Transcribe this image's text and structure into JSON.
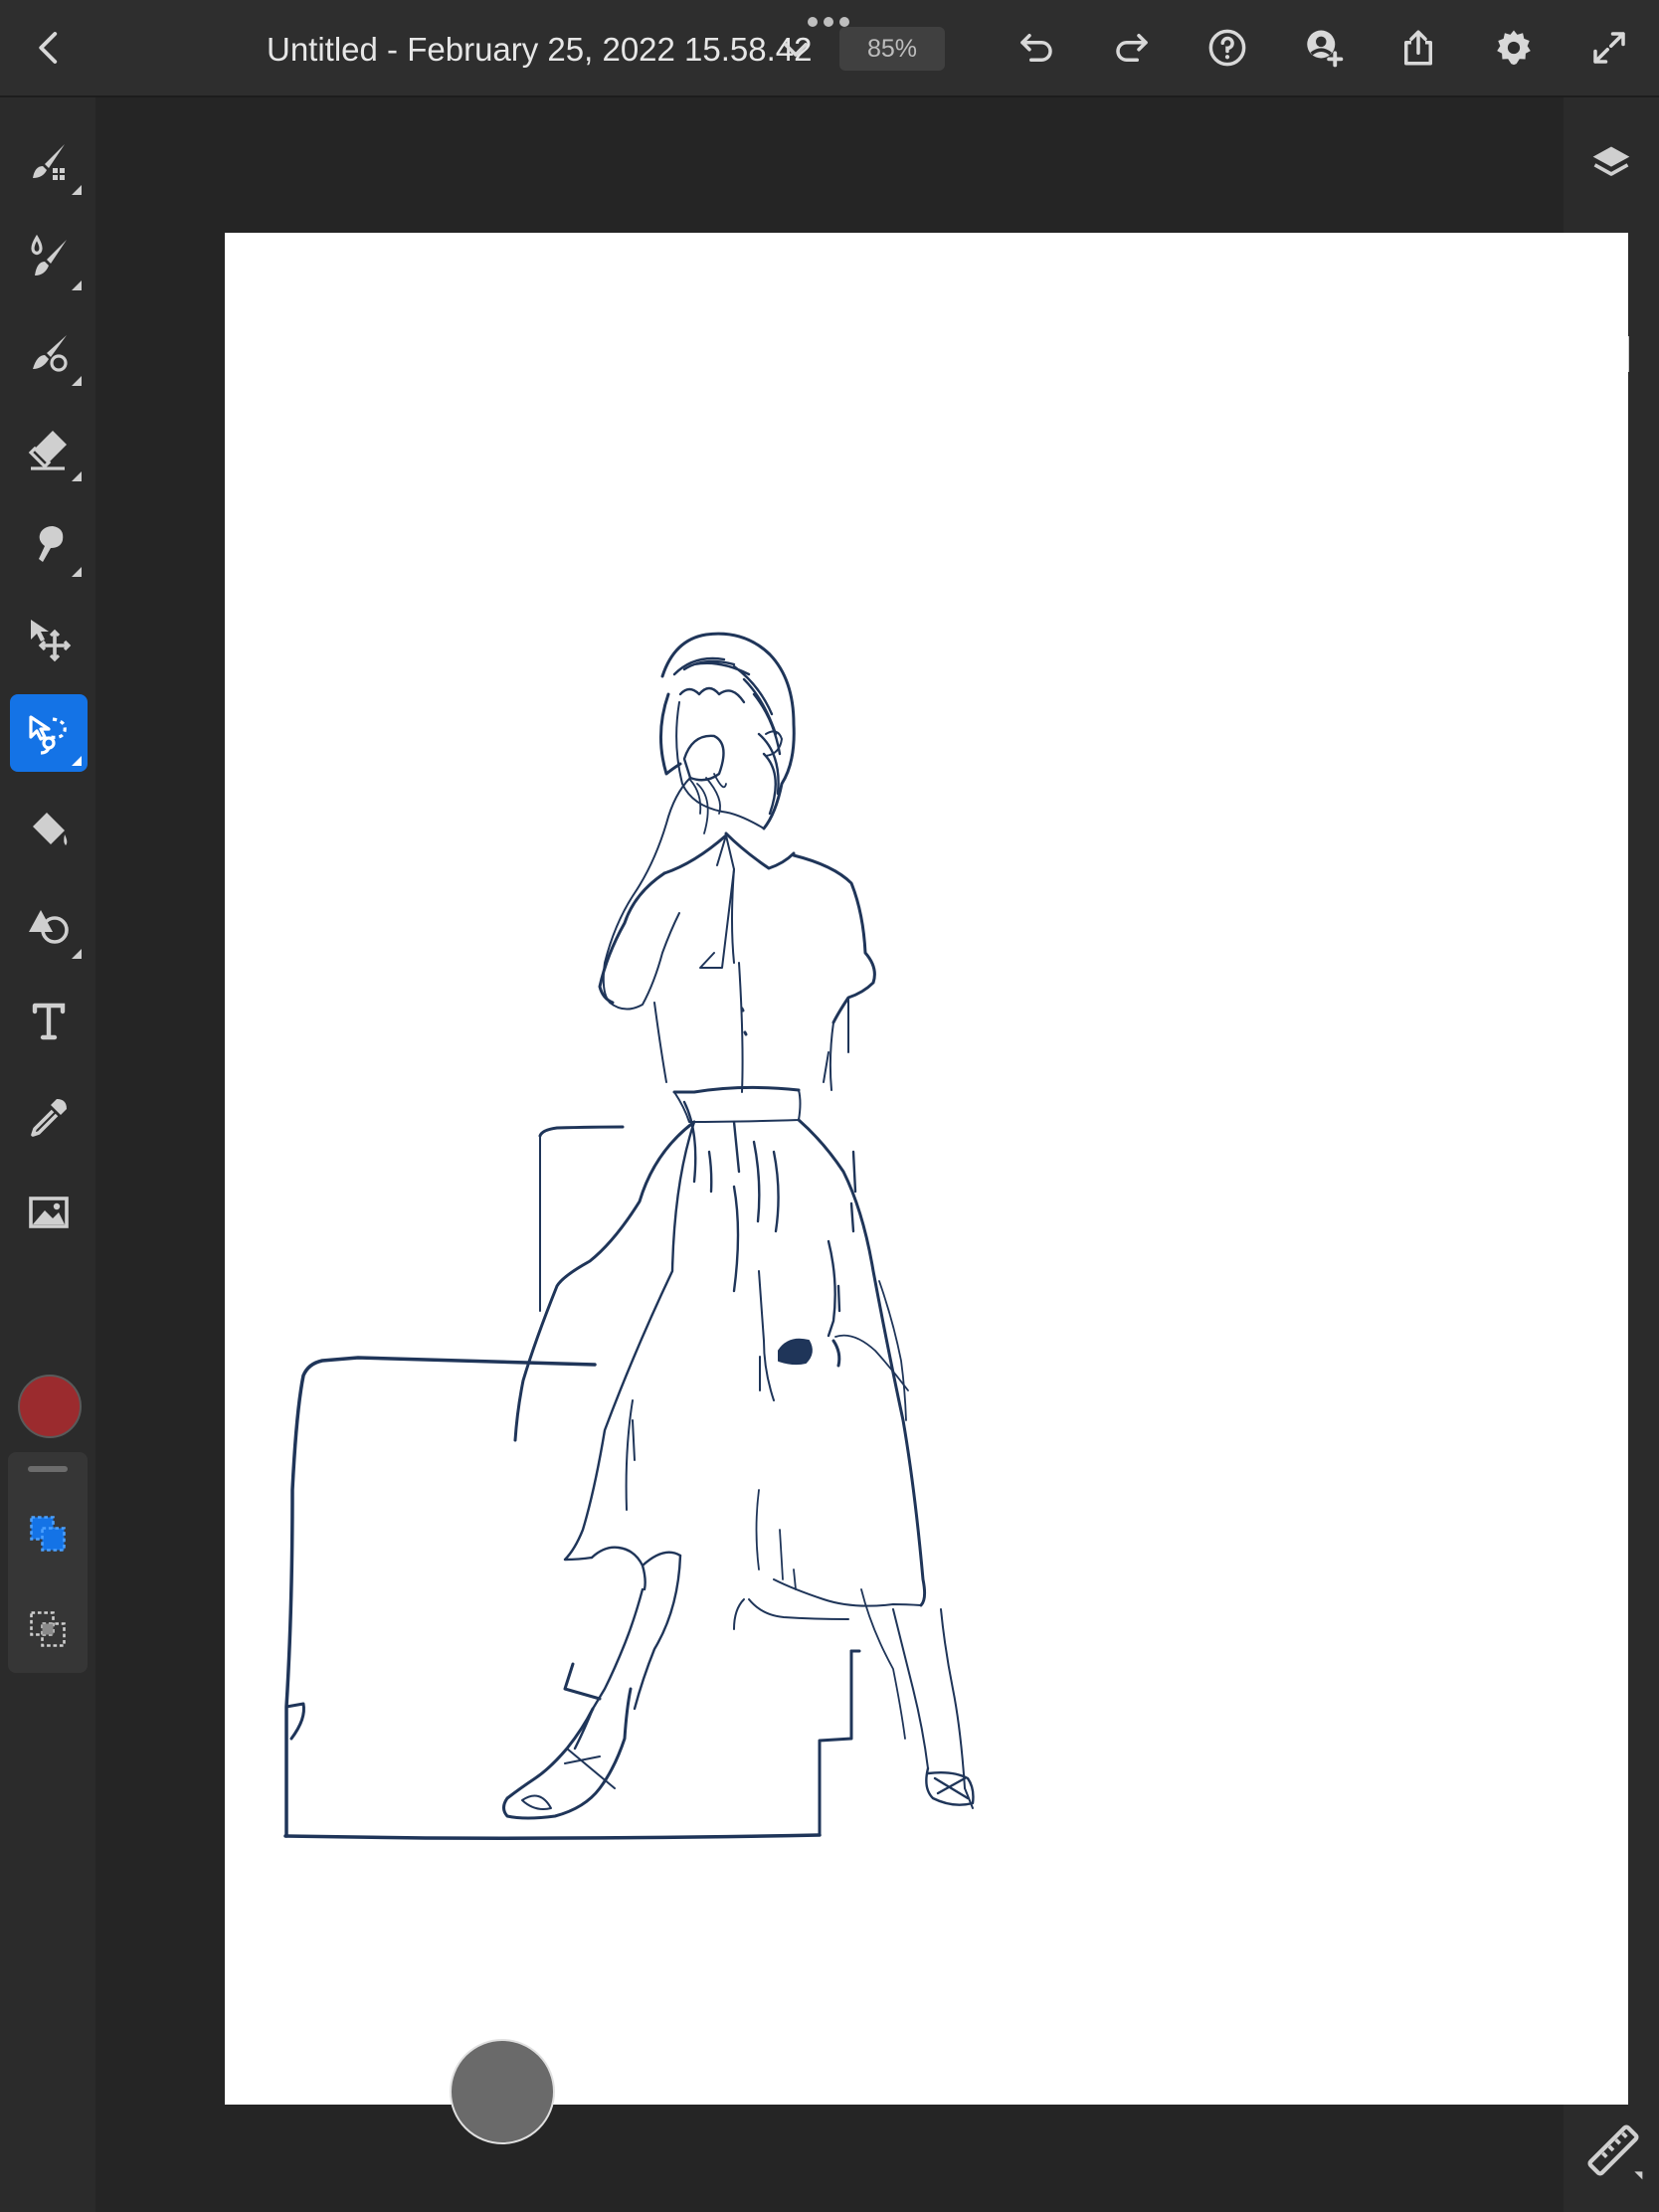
{
  "topbar": {
    "document_title": "Untitled - February 25, 2022 15.58.42",
    "zoom_level": "85%",
    "icons": [
      "back-icon",
      "chevron-down-icon",
      "more-icon",
      "undo-icon",
      "redo-icon",
      "help-icon",
      "invite-icon",
      "share-icon",
      "settings-icon",
      "fullscreen-icon"
    ]
  },
  "left_toolbar": {
    "tools": [
      "pixel-brush",
      "live-brush",
      "vector-brush",
      "eraser",
      "smudge",
      "move-transform",
      "lasso-selection",
      "fill",
      "shapes",
      "text",
      "eyedropper",
      "image",
      "color"
    ],
    "active_tool": "lasso-selection",
    "current_color": "#9b2b2e",
    "selection_panel": [
      "selection-add",
      "selection-subtract"
    ]
  },
  "right_toolbar": {
    "tools": [
      "layers",
      "properties",
      "grid",
      "comments",
      "ruler"
    ]
  },
  "canvas": {
    "background": "#ffffff",
    "stroke_color": "#1f3559",
    "subject": "line drawing"
  },
  "colors": {
    "app_bg": "#252525",
    "toolbar_bg": "#2b2b2b",
    "accent": "#1473e6",
    "icon": "#cfcfcf"
  }
}
